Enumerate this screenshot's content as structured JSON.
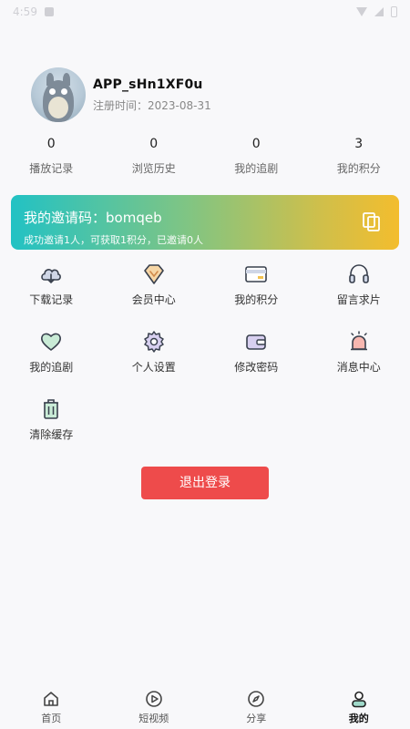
{
  "status_bar": {
    "time": "4:59"
  },
  "profile": {
    "username": "APP_sHn1XF0u",
    "reg_date": "注册时间：2023-08-31"
  },
  "stats": [
    {
      "value": "0",
      "label": "播放记录"
    },
    {
      "value": "0",
      "label": "浏览历史"
    },
    {
      "value": "0",
      "label": "我的追剧"
    },
    {
      "value": "3",
      "label": "我的积分"
    }
  ],
  "invite": {
    "prefix": "我的邀请码：",
    "code": "bomqeb",
    "note": "成功邀请1人，可获取1积分，已邀请0人"
  },
  "menu": [
    {
      "label": "下载记录",
      "icon": "cloud-download-icon"
    },
    {
      "label": "会员中心",
      "icon": "vip-diamond-icon"
    },
    {
      "label": "我的积分",
      "icon": "points-card-icon"
    },
    {
      "label": "留言求片",
      "icon": "headset-icon"
    },
    {
      "label": "我的追剧",
      "icon": "heart-icon"
    },
    {
      "label": "个人设置",
      "icon": "gear-icon"
    },
    {
      "label": "修改密码",
      "icon": "wallet-icon"
    },
    {
      "label": "消息中心",
      "icon": "alarm-bell-icon"
    },
    {
      "label": "清除缓存",
      "icon": "trash-icon"
    }
  ],
  "logout_label": "退出登录",
  "tabs": [
    {
      "label": "首页",
      "icon": "home-icon"
    },
    {
      "label": "短视频",
      "icon": "play-circle-icon"
    },
    {
      "label": "分享",
      "icon": "compass-icon"
    },
    {
      "label": "我的",
      "icon": "user-icon",
      "active": true
    }
  ],
  "colors": {
    "accent_red": "#ee4b4b",
    "invite_gradient_start": "#22c2c4",
    "invite_gradient_end": "#f3bd2e"
  }
}
